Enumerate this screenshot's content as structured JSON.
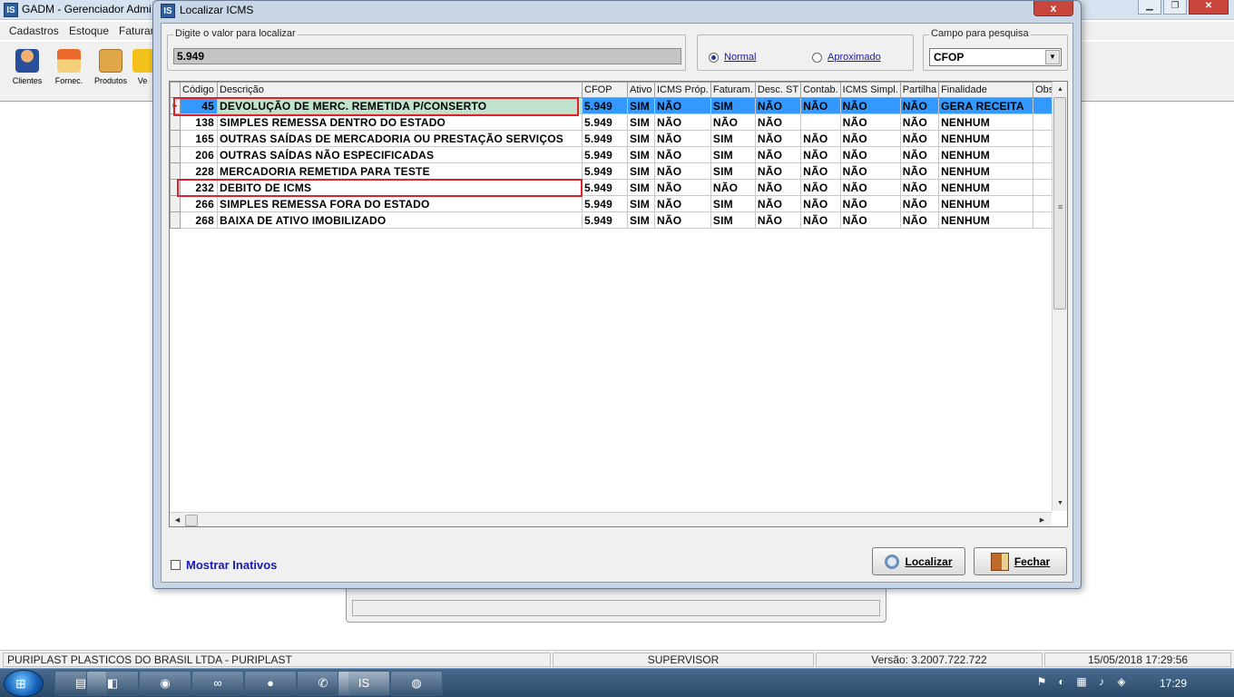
{
  "app": {
    "title": "GADM - Gerenciador Admi",
    "icon_text": "IS",
    "menu": [
      "Cadastros",
      "Estoque",
      "Faturam"
    ],
    "toolbar": [
      "Clientes",
      "Fornec.",
      "Produtos",
      "Ve"
    ]
  },
  "dialog": {
    "title": "Localizar ICMS",
    "icon_text": "IS",
    "close_label": "x",
    "search_group_label": "Digite o valor para localizar",
    "search_value": "5.949",
    "mode_options": [
      {
        "label": "Normal",
        "selected": true
      },
      {
        "label": "Aproximado",
        "selected": false
      }
    ],
    "field_group_label": "Campo para pesquisa",
    "field_value": "CFOP",
    "columns": [
      "Código",
      "Descrição",
      "CFOP",
      "Ativo",
      "ICMS Próp.",
      "Faturam.",
      "Desc. ST",
      "Contab.",
      "ICMS Simpl.",
      "Partilha",
      "Finalidade",
      "Obse"
    ],
    "rows": [
      {
        "cells": [
          "45",
          "DEVOLUÇÃO DE MERC. REMETIDA P/CONSERTO",
          "5.949",
          "SIM",
          "NÃO",
          "SIM",
          "NÃO",
          "NÃO",
          "NÃO",
          "NÃO",
          "GERA RECEITA",
          ""
        ],
        "selected": true,
        "highlighted": true
      },
      {
        "cells": [
          "138",
          "SIMPLES REMESSA DENTRO DO ESTADO",
          "5.949",
          "SIM",
          "NÃO",
          "NÃO",
          "NÃO",
          "",
          "NÃO",
          "NÃO",
          "NENHUM",
          ""
        ],
        "selected": false,
        "highlighted": false
      },
      {
        "cells": [
          "165",
          "OUTRAS SAÍDAS DE MERCADORIA OU PRESTAÇÃO SERVIÇOS",
          "5.949",
          "SIM",
          "NÃO",
          "SIM",
          "NÃO",
          "NÃO",
          "NÃO",
          "NÃO",
          "NENHUM",
          ""
        ],
        "selected": false,
        "highlighted": false
      },
      {
        "cells": [
          "206",
          "OUTRAS SAÍDAS NÃO ESPECIFICADAS",
          "5.949",
          "SIM",
          "NÃO",
          "SIM",
          "NÃO",
          "NÃO",
          "NÃO",
          "NÃO",
          "NENHUM",
          ""
        ],
        "selected": false,
        "highlighted": false
      },
      {
        "cells": [
          "228",
          "MERCADORIA REMETIDA PARA TESTE",
          "5.949",
          "SIM",
          "NÃO",
          "SIM",
          "NÃO",
          "NÃO",
          "NÃO",
          "NÃO",
          "NENHUM",
          ""
        ],
        "selected": false,
        "highlighted": false
      },
      {
        "cells": [
          "232",
          "DEBITO DE ICMS",
          "5.949",
          "SIM",
          "NÃO",
          "NÃO",
          "NÃO",
          "NÃO",
          "NÃO",
          "NÃO",
          "NENHUM",
          ""
        ],
        "selected": false,
        "highlighted": true
      },
      {
        "cells": [
          "266",
          "SIMPLES REMESSA FORA DO ESTADO",
          "5.949",
          "SIM",
          "NÃO",
          "SIM",
          "NÃO",
          "NÃO",
          "NÃO",
          "NÃO",
          "NENHUM",
          ""
        ],
        "selected": false,
        "highlighted": false
      },
      {
        "cells": [
          "268",
          "BAIXA DE ATIVO IMOBILIZADO",
          "5.949",
          "SIM",
          "NÃO",
          "SIM",
          "NÃO",
          "NÃO",
          "NÃO",
          "NÃO",
          "NENHUM",
          ""
        ],
        "selected": false,
        "highlighted": false
      }
    ],
    "show_inactive_label": "Mostrar Inativos",
    "show_inactive_checked": false,
    "find_button": "Localizar",
    "close_button": "Fechar"
  },
  "status": {
    "company": "PURIPLAST PLASTICOS DO BRASIL LTDA  - PURIPLAST",
    "user": "SUPERVISOR",
    "version": "Versão: 3.2007.722.722",
    "datetime": "15/05/2018 17:29:56"
  },
  "taskbar": {
    "clock": "17:29"
  },
  "colors": {
    "selection": "#3399ff",
    "highlight_box": "#e0202a",
    "link_blue": "#1a1ab0"
  }
}
